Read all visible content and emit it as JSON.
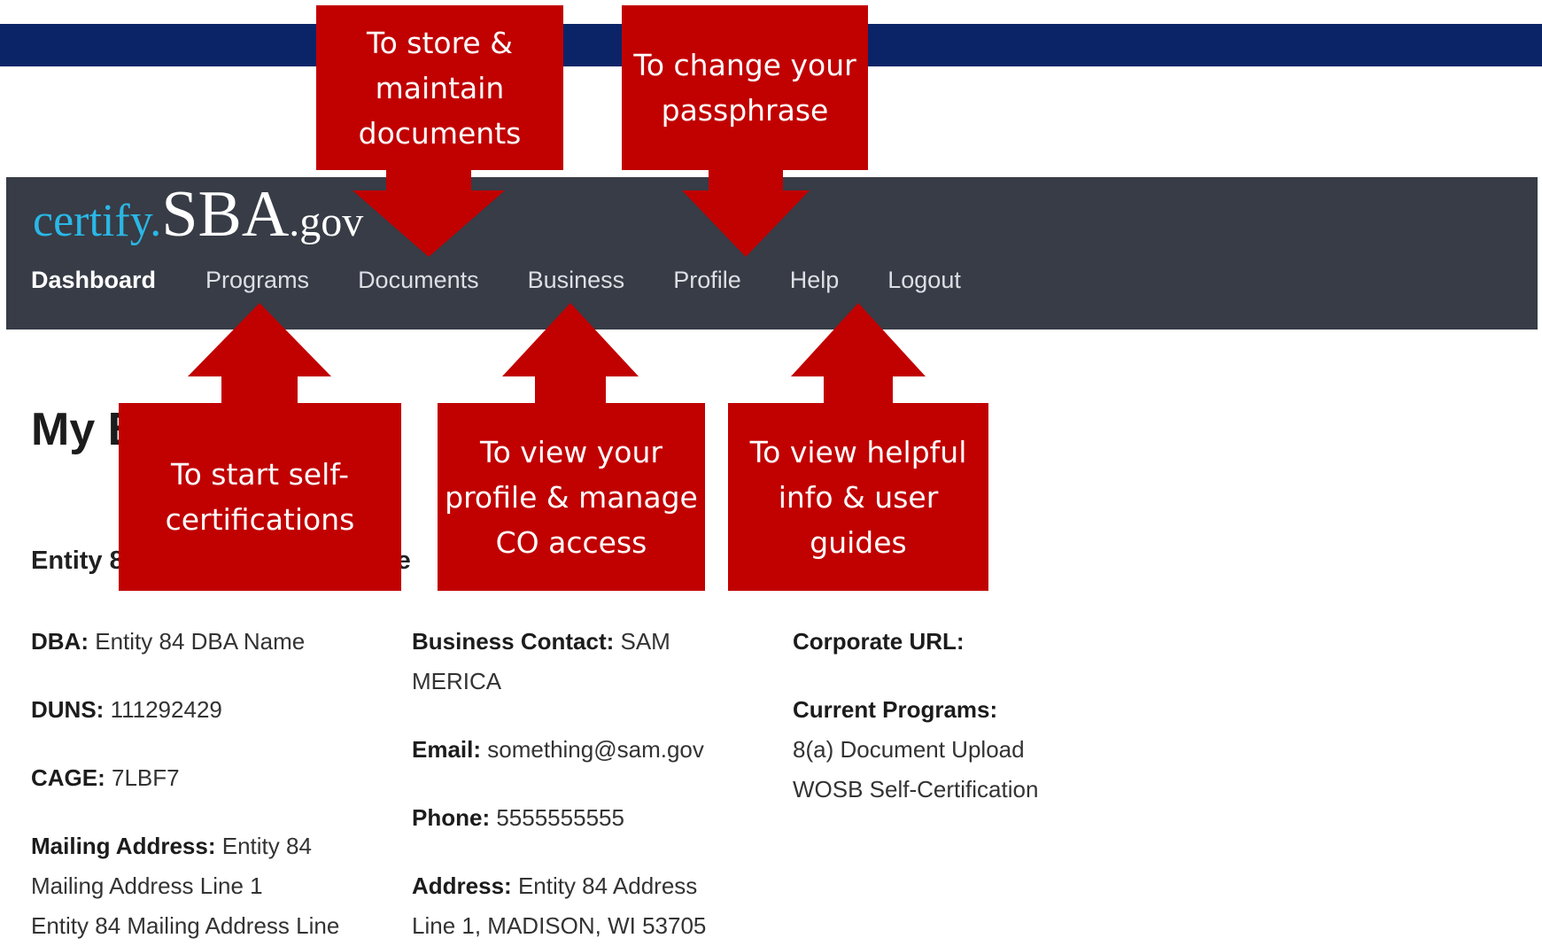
{
  "header": {
    "logo": {
      "part1": "certify.",
      "part2": "SBA",
      "part3": ".gov"
    },
    "nav": [
      "Dashboard",
      "Programs",
      "Documents",
      "Business",
      "Profile",
      "Help",
      "Logout"
    ]
  },
  "page": {
    "title": "My Business",
    "section_heading": "Entity 84 Legal Business Name"
  },
  "business": {
    "col1": {
      "dba_label": "DBA:",
      "dba_value": "Entity 84 DBA Name",
      "duns_label": "DUNS:",
      "duns_value": "111292429",
      "cage_label": "CAGE:",
      "cage_value": "7LBF7",
      "mailing_label": "Mailing Address:",
      "mailing_value": "Entity 84 Mailing Address Line 1",
      "mailing_cutoff": "Entity 84 Mailing Address Line"
    },
    "col2": {
      "contact_label": "Business Contact:",
      "contact_value": "SAM MERICA",
      "email_label": "Email:",
      "email_value": "something@sam.gov",
      "phone_label": "Phone:",
      "phone_value": "5555555555",
      "address_label": "Address:",
      "address_value": "Entity 84 Address",
      "address_cutoff": "Line 1, MADISON, WI 53705"
    },
    "col3": {
      "url_label": "Corporate URL:",
      "programs_label": "Current Programs:",
      "programs": [
        "8(a) Document Upload",
        "WOSB Self-Certification"
      ]
    }
  },
  "callouts": {
    "documents": "To store & maintain documents",
    "passphrase": "To change your passphrase",
    "programs": "To start self-certifications",
    "business": "To view your profile & manage CO access",
    "help": "To view helpful info & user guides"
  },
  "colors": {
    "banner": "#0b2467",
    "header": "#373c46",
    "logo_accent": "#2ab7e6",
    "callout": "#c10000"
  }
}
